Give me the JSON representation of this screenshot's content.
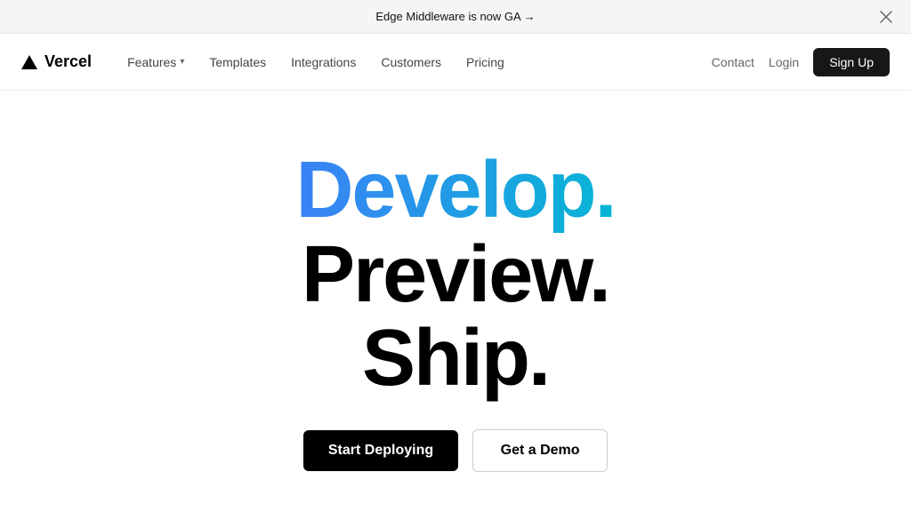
{
  "announcement": {
    "text": "Edge Middleware is now GA →",
    "close_label": "×"
  },
  "navbar": {
    "logo_text": "Vercel",
    "nav_links": [
      {
        "label": "Features",
        "has_dropdown": true
      },
      {
        "label": "Templates",
        "has_dropdown": false
      },
      {
        "label": "Integrations",
        "has_dropdown": false
      },
      {
        "label": "Customers",
        "has_dropdown": false
      },
      {
        "label": "Pricing",
        "has_dropdown": false
      }
    ],
    "right_links": [
      {
        "label": "Contact"
      },
      {
        "label": "Login"
      }
    ],
    "signup_label": "Sign Up"
  },
  "hero": {
    "line1": "Develop.",
    "line2": "Preview.",
    "line3": "Ship.",
    "button_primary": "Start Deploying",
    "button_secondary": "Get a Demo"
  }
}
